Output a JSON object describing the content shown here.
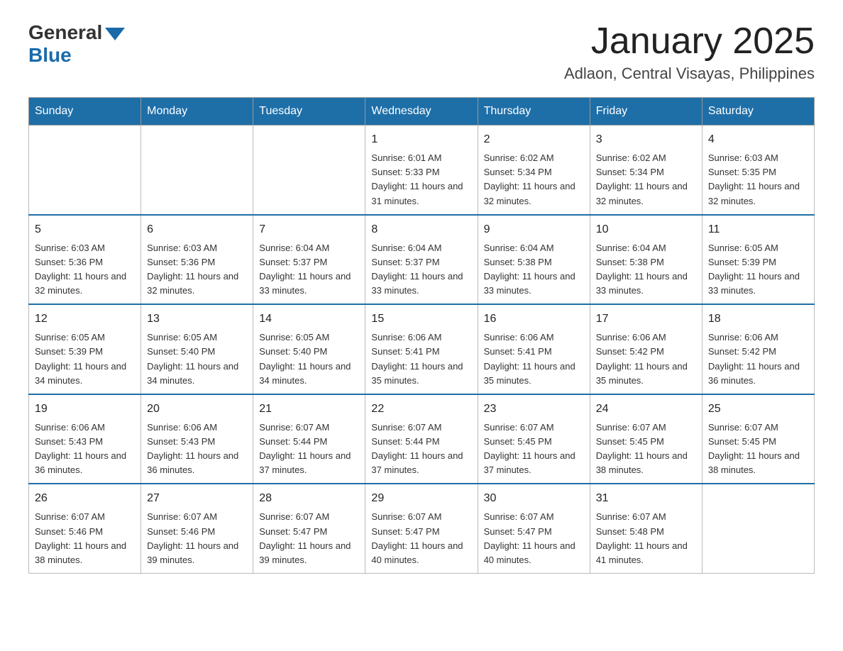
{
  "header": {
    "logo_general": "General",
    "logo_blue": "Blue",
    "month_year": "January 2025",
    "location": "Adlaon, Central Visayas, Philippines"
  },
  "days_of_week": [
    "Sunday",
    "Monday",
    "Tuesday",
    "Wednesday",
    "Thursday",
    "Friday",
    "Saturday"
  ],
  "weeks": [
    [
      {
        "day": "",
        "info": ""
      },
      {
        "day": "",
        "info": ""
      },
      {
        "day": "",
        "info": ""
      },
      {
        "day": "1",
        "info": "Sunrise: 6:01 AM\nSunset: 5:33 PM\nDaylight: 11 hours and 31 minutes."
      },
      {
        "day": "2",
        "info": "Sunrise: 6:02 AM\nSunset: 5:34 PM\nDaylight: 11 hours and 32 minutes."
      },
      {
        "day": "3",
        "info": "Sunrise: 6:02 AM\nSunset: 5:34 PM\nDaylight: 11 hours and 32 minutes."
      },
      {
        "day": "4",
        "info": "Sunrise: 6:03 AM\nSunset: 5:35 PM\nDaylight: 11 hours and 32 minutes."
      }
    ],
    [
      {
        "day": "5",
        "info": "Sunrise: 6:03 AM\nSunset: 5:36 PM\nDaylight: 11 hours and 32 minutes."
      },
      {
        "day": "6",
        "info": "Sunrise: 6:03 AM\nSunset: 5:36 PM\nDaylight: 11 hours and 32 minutes."
      },
      {
        "day": "7",
        "info": "Sunrise: 6:04 AM\nSunset: 5:37 PM\nDaylight: 11 hours and 33 minutes."
      },
      {
        "day": "8",
        "info": "Sunrise: 6:04 AM\nSunset: 5:37 PM\nDaylight: 11 hours and 33 minutes."
      },
      {
        "day": "9",
        "info": "Sunrise: 6:04 AM\nSunset: 5:38 PM\nDaylight: 11 hours and 33 minutes."
      },
      {
        "day": "10",
        "info": "Sunrise: 6:04 AM\nSunset: 5:38 PM\nDaylight: 11 hours and 33 minutes."
      },
      {
        "day": "11",
        "info": "Sunrise: 6:05 AM\nSunset: 5:39 PM\nDaylight: 11 hours and 33 minutes."
      }
    ],
    [
      {
        "day": "12",
        "info": "Sunrise: 6:05 AM\nSunset: 5:39 PM\nDaylight: 11 hours and 34 minutes."
      },
      {
        "day": "13",
        "info": "Sunrise: 6:05 AM\nSunset: 5:40 PM\nDaylight: 11 hours and 34 minutes."
      },
      {
        "day": "14",
        "info": "Sunrise: 6:05 AM\nSunset: 5:40 PM\nDaylight: 11 hours and 34 minutes."
      },
      {
        "day": "15",
        "info": "Sunrise: 6:06 AM\nSunset: 5:41 PM\nDaylight: 11 hours and 35 minutes."
      },
      {
        "day": "16",
        "info": "Sunrise: 6:06 AM\nSunset: 5:41 PM\nDaylight: 11 hours and 35 minutes."
      },
      {
        "day": "17",
        "info": "Sunrise: 6:06 AM\nSunset: 5:42 PM\nDaylight: 11 hours and 35 minutes."
      },
      {
        "day": "18",
        "info": "Sunrise: 6:06 AM\nSunset: 5:42 PM\nDaylight: 11 hours and 36 minutes."
      }
    ],
    [
      {
        "day": "19",
        "info": "Sunrise: 6:06 AM\nSunset: 5:43 PM\nDaylight: 11 hours and 36 minutes."
      },
      {
        "day": "20",
        "info": "Sunrise: 6:06 AM\nSunset: 5:43 PM\nDaylight: 11 hours and 36 minutes."
      },
      {
        "day": "21",
        "info": "Sunrise: 6:07 AM\nSunset: 5:44 PM\nDaylight: 11 hours and 37 minutes."
      },
      {
        "day": "22",
        "info": "Sunrise: 6:07 AM\nSunset: 5:44 PM\nDaylight: 11 hours and 37 minutes."
      },
      {
        "day": "23",
        "info": "Sunrise: 6:07 AM\nSunset: 5:45 PM\nDaylight: 11 hours and 37 minutes."
      },
      {
        "day": "24",
        "info": "Sunrise: 6:07 AM\nSunset: 5:45 PM\nDaylight: 11 hours and 38 minutes."
      },
      {
        "day": "25",
        "info": "Sunrise: 6:07 AM\nSunset: 5:45 PM\nDaylight: 11 hours and 38 minutes."
      }
    ],
    [
      {
        "day": "26",
        "info": "Sunrise: 6:07 AM\nSunset: 5:46 PM\nDaylight: 11 hours and 38 minutes."
      },
      {
        "day": "27",
        "info": "Sunrise: 6:07 AM\nSunset: 5:46 PM\nDaylight: 11 hours and 39 minutes."
      },
      {
        "day": "28",
        "info": "Sunrise: 6:07 AM\nSunset: 5:47 PM\nDaylight: 11 hours and 39 minutes."
      },
      {
        "day": "29",
        "info": "Sunrise: 6:07 AM\nSunset: 5:47 PM\nDaylight: 11 hours and 40 minutes."
      },
      {
        "day": "30",
        "info": "Sunrise: 6:07 AM\nSunset: 5:47 PM\nDaylight: 11 hours and 40 minutes."
      },
      {
        "day": "31",
        "info": "Sunrise: 6:07 AM\nSunset: 5:48 PM\nDaylight: 11 hours and 41 minutes."
      },
      {
        "day": "",
        "info": ""
      }
    ]
  ]
}
